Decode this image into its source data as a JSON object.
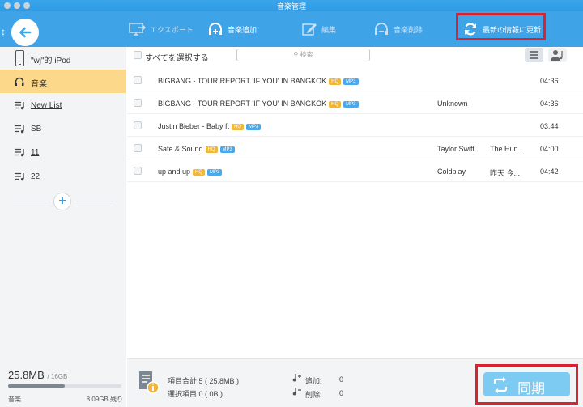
{
  "window": {
    "title": "音楽管理"
  },
  "toolbar": {
    "export_label": "エクスポート",
    "add_music_label": "音楽追加",
    "edit_label": "編集",
    "delete_music_label": "音楽削除",
    "refresh_label": "最新の情報に更新"
  },
  "sidebar": {
    "device_name": "\"wj\"的 iPod",
    "items": [
      {
        "label": "音楽",
        "active": true,
        "icon": "headphones-icon"
      },
      {
        "label": "New List",
        "icon": "playlist-icon"
      },
      {
        "label": "SB",
        "icon": "playlist-icon"
      },
      {
        "label": "11",
        "icon": "playlist-icon"
      },
      {
        "label": "22",
        "icon": "playlist-icon"
      }
    ],
    "storage_used": "25.8MB",
    "storage_total": "/ 16GB",
    "storage_used_fraction": 0.5,
    "storage_category": "音楽",
    "storage_remaining": "8.09GB 残り"
  },
  "main": {
    "select_all_label": "すべてを選択する",
    "search_placeholder": "検索",
    "badge_hq": "HQ",
    "badge_mp3": "MP3",
    "songs": [
      {
        "title": "BIGBANG - TOUR REPORT 'IF YOU' IN BANGKOK",
        "hq": true,
        "artist": "",
        "album": "",
        "duration": "04:36"
      },
      {
        "title": "BIGBANG - TOUR REPORT 'IF YOU' IN BANGKOK",
        "hq": true,
        "artist": "Unknown",
        "album": "",
        "duration": "04:36"
      },
      {
        "title": "Justin Bieber - Baby ft",
        "hq": true,
        "artist": "",
        "album": "",
        "duration": "03:44"
      },
      {
        "title": "Safe & Sound",
        "hq": true,
        "artist": "Taylor Swift",
        "album": "The Hun...",
        "duration": "04:00"
      },
      {
        "title": "up and up",
        "hq": true,
        "artist": "Coldplay",
        "album": "昨天 今...",
        "duration": "04:42"
      }
    ]
  },
  "footer": {
    "total_items": "項目合計 5 ( 25.8MB )",
    "selected_items": "選択項目 0 ( 0B )",
    "added_label": "追加:",
    "added_count": "0",
    "deleted_label": "削除:",
    "deleted_count": "0",
    "sync_label": "同期"
  },
  "colors": {
    "toolbar_blue": "#3fa3e8",
    "active_item": "#fcd98a",
    "highlight_red": "#d9232e",
    "sync_button": "#7dcaf2",
    "hq_badge": "#f0b63c",
    "mp3_badge": "#4aa9ea"
  }
}
